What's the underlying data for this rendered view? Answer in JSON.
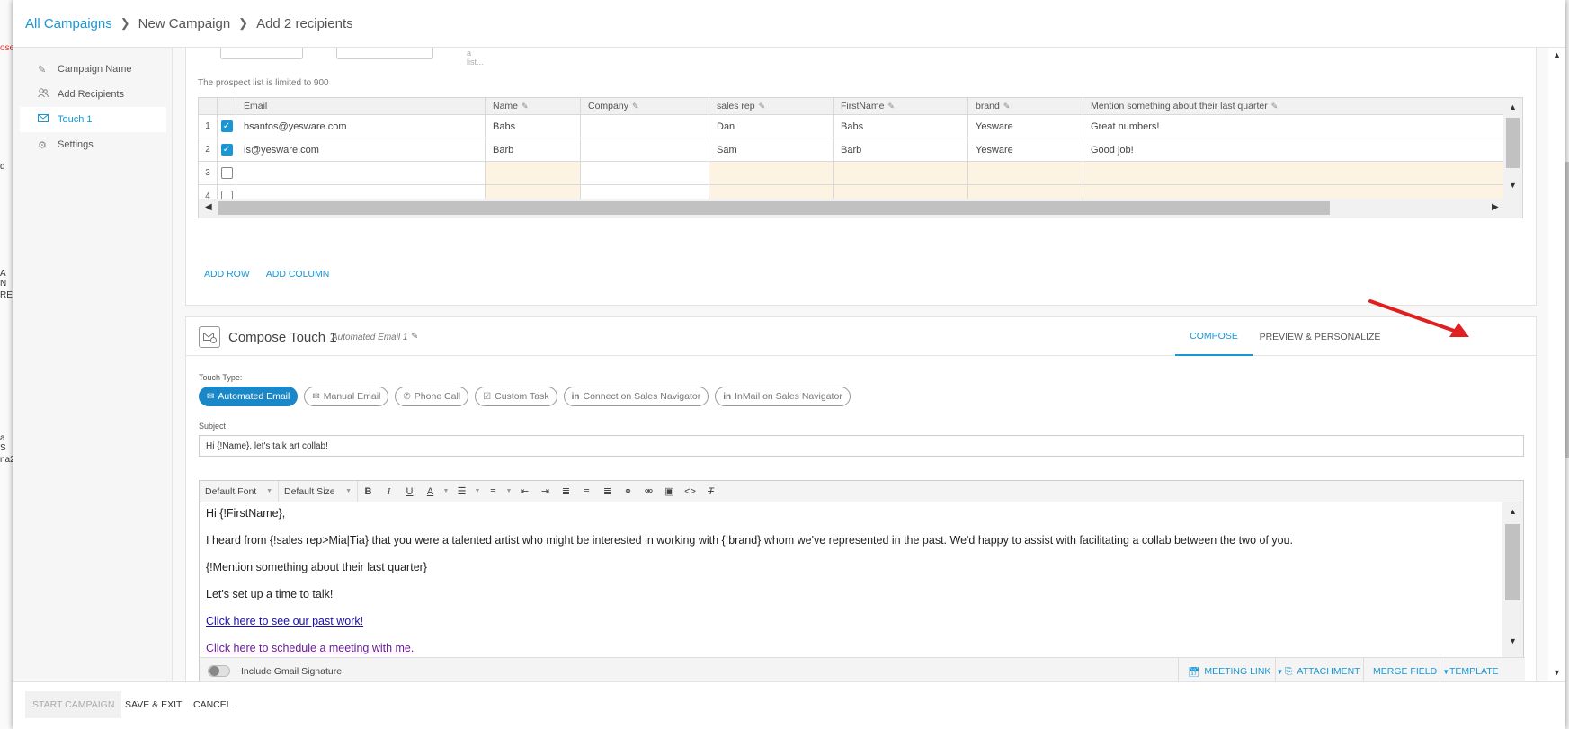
{
  "breadcrumb": {
    "root": "All Campaigns",
    "step": "New Campaign",
    "current": "Add 2 recipients"
  },
  "background_fragments": [
    "ose",
    "d",
    "A N",
    "RE",
    "a S",
    "na2"
  ],
  "sidebar": {
    "items": [
      {
        "label": "Campaign Name",
        "icon": "pencil-icon"
      },
      {
        "label": "Add Recipients",
        "icon": "users-icon"
      },
      {
        "label": "Touch 1",
        "icon": "email-icon",
        "active": true
      },
      {
        "label": "Settings",
        "icon": "gear-icon"
      }
    ]
  },
  "recipients": {
    "top_placeholder": "Select a list...",
    "limit_text": "The prospect list is limited to 900",
    "columns": [
      "Email",
      "Name",
      "Company",
      "sales rep",
      "FirstName",
      "brand",
      "Mention something about their last quarter"
    ],
    "rows": [
      {
        "num": "1",
        "checked": true,
        "cells": [
          "bsantos@yesware.com",
          "Babs",
          "",
          "Dan",
          "Babs",
          "Yesware",
          "Great numbers!"
        ]
      },
      {
        "num": "2",
        "checked": true,
        "cells": [
          "is@yesware.com",
          "Barb",
          "",
          "Sam",
          "Barb",
          "Yesware",
          "Good job!"
        ]
      },
      {
        "num": "3",
        "checked": false,
        "cells": [
          "",
          "",
          "",
          "",
          "",
          "",
          ""
        ]
      },
      {
        "num": "4",
        "checked": false,
        "cells": [
          "",
          "",
          "",
          "",
          "",
          "",
          ""
        ]
      }
    ],
    "add_row": "ADD ROW",
    "add_column": "ADD COLUMN"
  },
  "compose": {
    "title": "Compose Touch 1",
    "subtitle": "Automated Email 1",
    "tabs": [
      "COMPOSE",
      "PREVIEW & PERSONALIZE"
    ],
    "touch_type_label": "Touch Type:",
    "touch_types": [
      {
        "label": "Automated Email",
        "icon": "email-icon",
        "active": true
      },
      {
        "label": "Manual Email",
        "icon": "email-icon"
      },
      {
        "label": "Phone Call",
        "icon": "phone-icon"
      },
      {
        "label": "Custom Task",
        "icon": "task-icon"
      },
      {
        "label": "Connect on Sales Navigator",
        "icon": "linkedin-icon"
      },
      {
        "label": "InMail on Sales Navigator",
        "icon": "linkedin-icon"
      }
    ],
    "subject_label": "Subject",
    "subject_value": "Hi {!Name}, let's talk art collab!",
    "font_select": "Default Font",
    "size_select": "Default Size",
    "body": {
      "greeting": "Hi {!FirstName},",
      "para1": "I heard from {!sales rep>Mia|Tia} that you were a talented artist who might be interested in working with {!brand} whom we've represented in the past. We'd happy to assist with facilitating a collab between the two of you.",
      "para2": "{!Mention something about their last quarter}",
      "para3": "Let's set up a time to talk!",
      "link1": "Click here to see our past work!",
      "link2": "Click here to schedule a meeting with me."
    },
    "signature_label": "Include Gmail Signature",
    "footer_buttons": {
      "meeting": "MEETING LINK",
      "attachment": "ATTACHMENT",
      "merge": "MERGE FIELD",
      "template": "TEMPLATE"
    }
  },
  "footer": {
    "start": "START CAMPAIGN",
    "save": "SAVE & EXIT",
    "cancel": "CANCEL"
  },
  "colors": {
    "accent": "#1a96d4",
    "active_pill": "#1a87c9",
    "annotation_arrow": "#e02020",
    "peach_cell": "#fdf3e3"
  }
}
